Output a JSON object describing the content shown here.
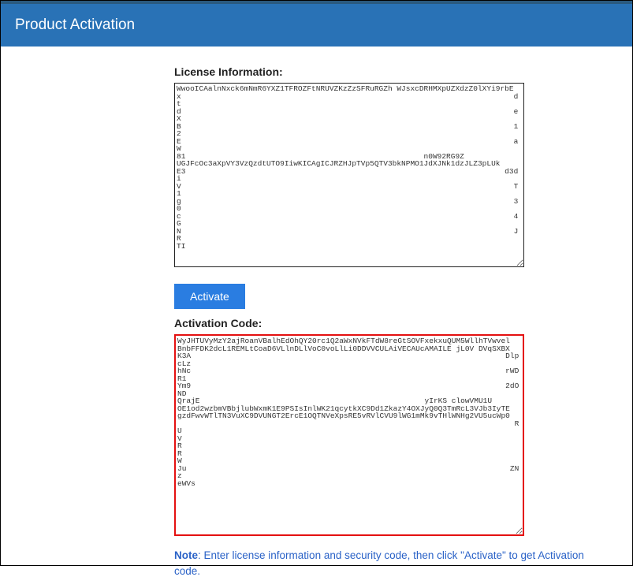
{
  "header": {
    "title": "Product Activation"
  },
  "license": {
    "label": "License Information:",
    "value": "WwooICAalnNxck6mNmR6YXZ1TFROZFtNRUVZKzZzSFRuRGZh WJsxcDRHMXpUZXdzZ0lXYi9rbE\nx                                                                          dt\nd                                                                          eX\nB                                                                          12\nE                                                                          aW\n81                                                     n0W92RG9Z\nUGJFcOc3aXpVY3VzQzdtUTO9IiwKICAgICJRZHJpTVp5QTV3bkNPMO1JdXJNk1dzJLZ3pLUk\nE3                                                                       d3di\nV                                                                          T1\ng                                                                          30\nc                                                                          4G\nN                                                                          JR\nTI                                                     "
  },
  "activate": {
    "label": "Activate"
  },
  "activation": {
    "label": "Activation Code:",
    "value": "WyJHTUVyMzY2ajRoanVBalhEdOhQY20rc1Q2aWxNVkFTdW8reGtSOVFxekxuQUM5WllhTVwvel\nBnbFFDK2dcL1REMLtCoaD6VLlnDLlVoC0voLlLi0DDVVCULAiVECAUcAMAILE jL0V DVqSXBX\nK3A                                                                      DlpcLz\nhNc                                                                      rWDR1\nYm9                                                                      2dOND\nQrajE                                                  yIrKS clowVMU1U\nOE1od2wzbmVBbjlubWxmK1E9PSIsInlWK21qcytkXC9Dd1ZkazY4OXJyQ0Q3TmRcL3VJb3IyTE\ngzdFwvWTlTN3VuXC9DVUNGT2ErcE1OQTNVeXpsRE5vRVlCVU9lWG1mMk9vTHlWNHg2VU5ucWp0\n                                                                           RU\nV                                                                           R\nR                                                                           W\nJu                                                                        ZNz\neWVs"
  },
  "note": {
    "bold": "Note",
    "text": ": Enter license information and security code, then click \"Activate\" to get Activation code."
  }
}
